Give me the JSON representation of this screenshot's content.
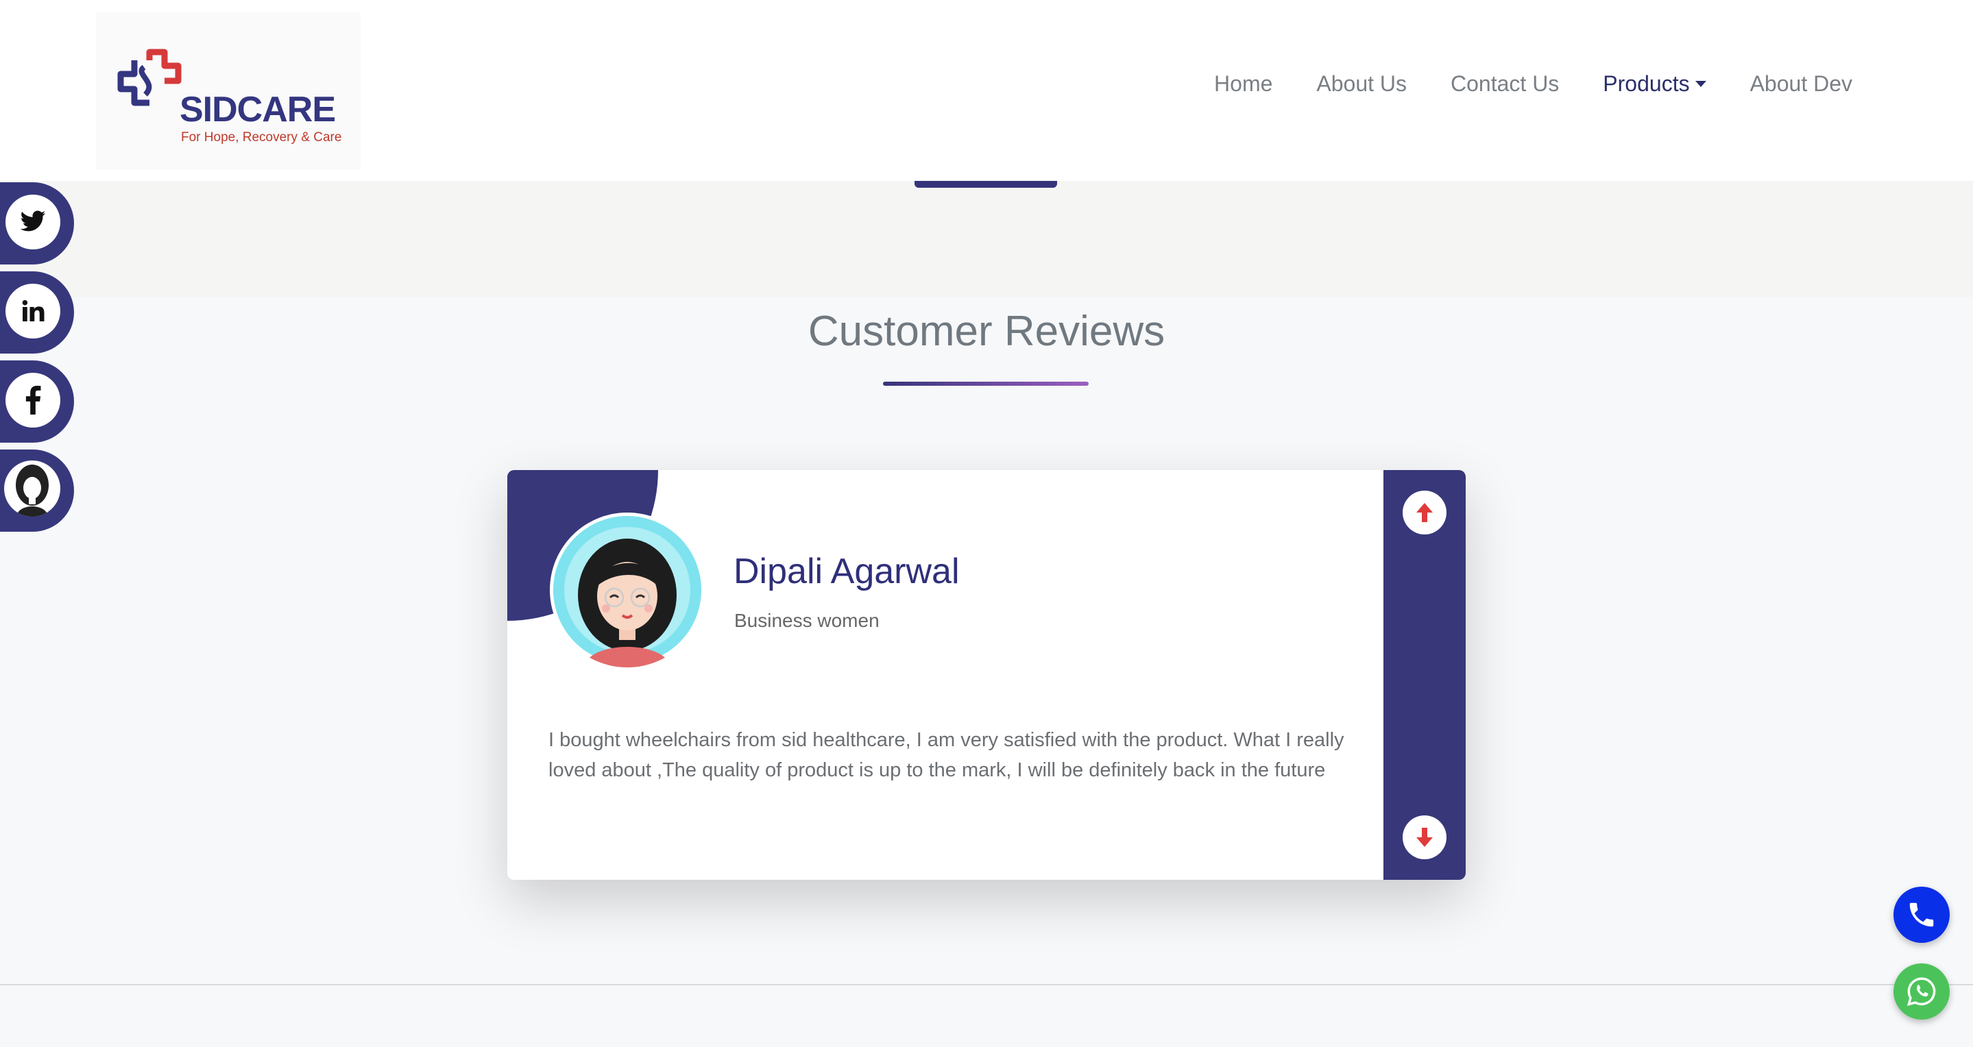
{
  "header": {
    "logo": {
      "title": "SIDCARE",
      "tagline": "For Hope, Recovery & Care"
    },
    "nav": [
      {
        "label": "Home"
      },
      {
        "label": "About Us"
      },
      {
        "label": "Contact Us"
      },
      {
        "label": "Products",
        "active": true,
        "dropdown": true
      },
      {
        "label": "About Dev"
      }
    ]
  },
  "social": [
    "twitter-icon",
    "linkedin-icon",
    "facebook-icon",
    "profile-avatar"
  ],
  "reviews": {
    "title": "Customer Reviews",
    "card": {
      "name": "Dipali Agarwal",
      "role": "Business women",
      "text": "I bought wheelchairs from sid healthcare, I am very satisfied with the product. What I really loved about ,The quality of product is up to the mark, I will be definitely back in the future"
    }
  },
  "colors": {
    "brand": "#37377a",
    "accent_red": "#e03b3b",
    "phone": "#0a2fe8",
    "whatsapp": "#4cc35a"
  }
}
